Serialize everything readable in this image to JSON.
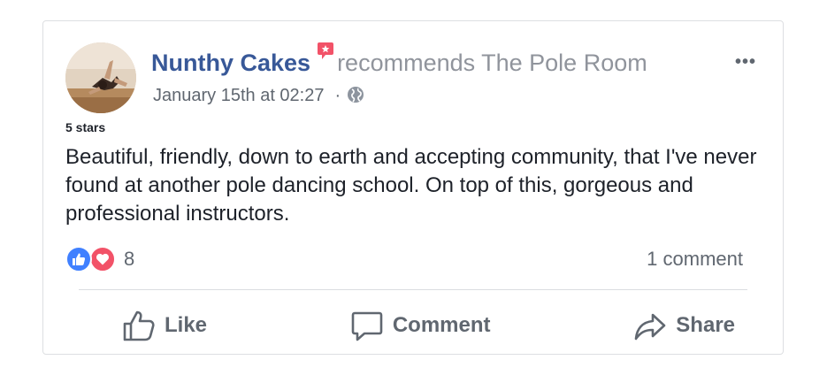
{
  "post": {
    "author": "Nunthy Cakes",
    "action": "recommends The Pole Room",
    "timestamp": "January 15th at 02:27",
    "separator": "·",
    "privacy_icon": "globe-icon",
    "rating": "5 stars",
    "body": "Beautiful, friendly, down to earth and accepting community, that I've never found at another pole dancing school. On top of this, gorgeous and professional instructors.",
    "more_label": "•••"
  },
  "reactions": {
    "types": [
      "like-icon",
      "love-icon"
    ],
    "count": "8",
    "comments": "1 comment"
  },
  "actions": {
    "like": "Like",
    "comment": "Comment",
    "share": "Share"
  },
  "colors": {
    "author": "#385898",
    "muted": "#90949c",
    "text": "#1d2129",
    "secondary": "#606770",
    "like_blue": "#4080ff",
    "love_red": "#f25268",
    "recommend_red": "#f25268"
  }
}
